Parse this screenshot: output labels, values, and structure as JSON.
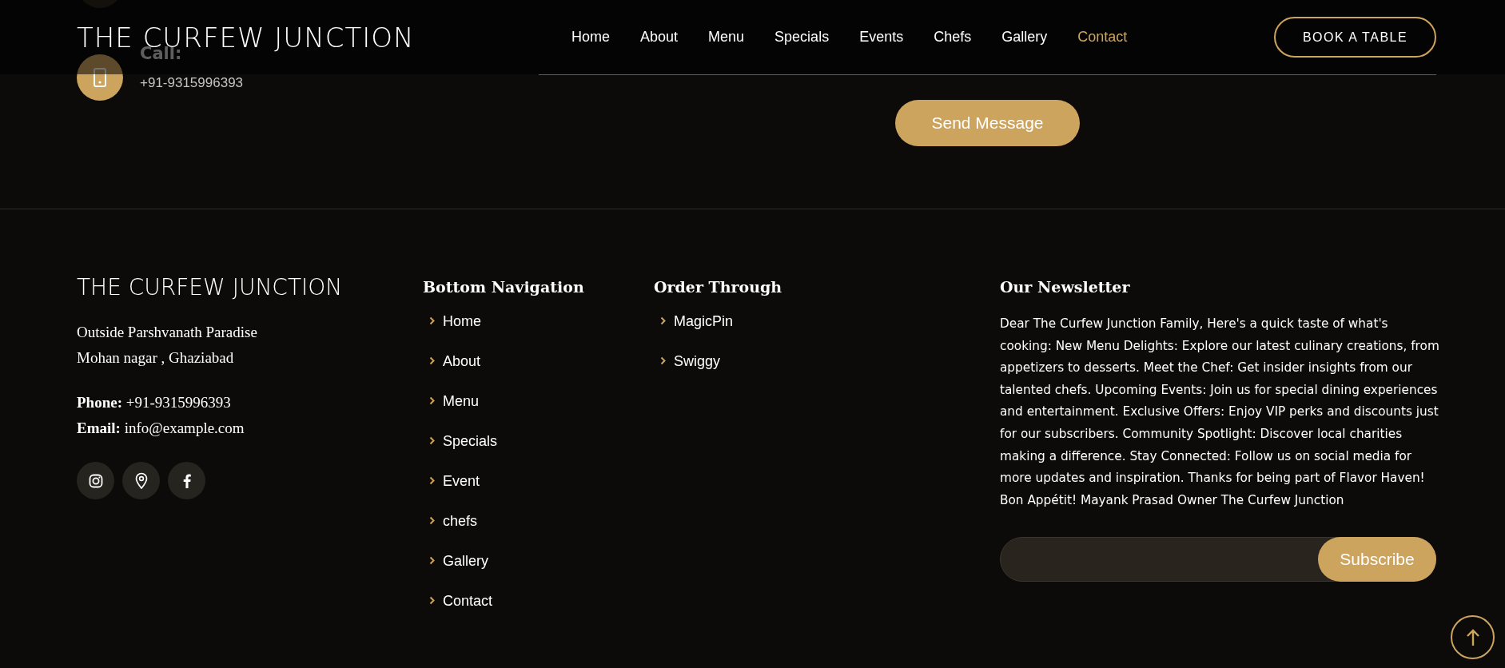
{
  "header": {
    "logo": "THE CURFEW JUNCTION",
    "nav": [
      {
        "label": "Home",
        "selected": false
      },
      {
        "label": "About",
        "selected": false
      },
      {
        "label": "Menu",
        "selected": false
      },
      {
        "label": "Specials",
        "selected": false
      },
      {
        "label": "Events",
        "selected": false
      },
      {
        "label": "Chefs",
        "selected": false
      },
      {
        "label": "Gallery",
        "selected": false
      },
      {
        "label": "Contact",
        "selected": true
      }
    ],
    "cta": "BOOK A TABLE"
  },
  "contact": {
    "call": {
      "label": "Call:",
      "value": "+91-9315996393"
    },
    "send_button": "Send Message"
  },
  "footer": {
    "brand": "THE CURFEW JUNCTION",
    "address": [
      "Outside Parshvanath Paradise",
      "Mohan nagar , Ghaziabad"
    ],
    "phone": "**Phone:** +91-9315996393",
    "email": "**Email:** info@example.com",
    "columns": [
      {
        "title": "Bottom Navigation",
        "links": [
          "Home",
          "About",
          "Menu",
          "Specials",
          "Event",
          "chefs",
          "Gallery",
          "Contact"
        ]
      },
      {
        "title": "Order Through",
        "links": [
          "MagicPin",
          "Swiggy"
        ]
      }
    ],
    "newsletter": {
      "title": "Our Newsletter",
      "text": "Dear The Curfew Junction Family, Here's a quick taste of what's cooking: New Menu Delights: Explore our latest culinary creations, from appetizers to desserts. Meet the Chef: Get insider insights from our talented chefs. Upcoming Events: Join us for special dining experiences and entertainment. Exclusive Offers: Enjoy VIP perks and discounts just for our subscribers. Community Spotlight: Discover local charities making a difference. Stay Connected: Follow us on social media for more updates and inspiration. Thanks for being part of Flavor Haven! Bon Appétit! Mayank Prasad Owner The Curfew Junction",
      "subscribe": "Subscribe"
    }
  }
}
